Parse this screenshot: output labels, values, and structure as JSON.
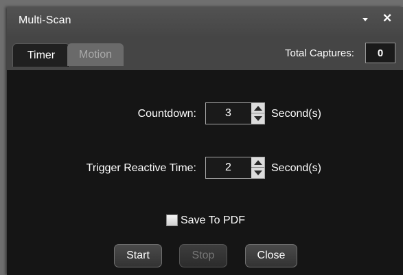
{
  "window": {
    "title": "Multi-Scan"
  },
  "tabs": [
    {
      "label": "Timer",
      "active": true
    },
    {
      "label": "Motion",
      "active": false
    }
  ],
  "total_captures": {
    "label": "Total Captures:",
    "value": "0"
  },
  "countdown": {
    "label": "Countdown:",
    "value": "3",
    "unit": "Second(s)"
  },
  "trigger": {
    "label": "Trigger Reactive Time:",
    "value": "2",
    "unit": "Second(s)"
  },
  "save_pdf": {
    "label": "Save To PDF",
    "checked": false
  },
  "buttons": {
    "start": "Start",
    "stop": "Stop",
    "close": "Close"
  },
  "icons": {
    "dropdown": "chevron-down-icon",
    "close": "close-icon",
    "spin_up": "spin-up-icon",
    "spin_down": "spin-down-icon"
  }
}
